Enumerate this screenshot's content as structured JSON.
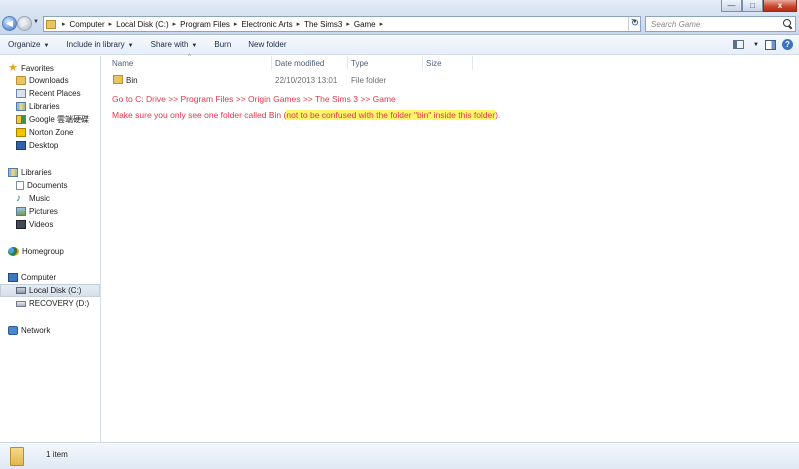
{
  "address": {
    "crumbs": [
      "Computer",
      "Local Disk (C:)",
      "Program Files",
      "Electronic Arts",
      "The Sims3",
      "Game"
    ],
    "search_placeholder": "Search Game"
  },
  "window_buttons": {
    "minimize": "—",
    "maximize": "□",
    "close": "x"
  },
  "toolbar": {
    "organize": "Organize",
    "include_in_library": "Include in library",
    "share_with": "Share with",
    "burn": "Burn",
    "new_folder": "New folder"
  },
  "navpane": {
    "favorites": {
      "header": "Favorites",
      "items": [
        "Downloads",
        "Recent Places",
        "Libraries",
        "Google 雲端硬碟",
        "Norton Zone",
        "Desktop"
      ]
    },
    "libraries": {
      "header": "Libraries",
      "items": [
        "Documents",
        "Music",
        "Pictures",
        "Videos"
      ]
    },
    "homegroup": "Homegroup",
    "computer": {
      "header": "Computer",
      "items": [
        "Local Disk (C:)",
        "RECOVERY (D:)"
      ]
    },
    "network": "Network"
  },
  "columns": {
    "name": "Name",
    "date_modified": "Date modified",
    "type": "Type",
    "size": "Size"
  },
  "files": [
    {
      "name": "Bin",
      "date_modified": "22/10/2013 13:01",
      "type": "File folder",
      "size": ""
    }
  ],
  "annotations": {
    "line1": "Go to C: Drive >> Program Files >> Origin Games >> The Sims 3 >> Game",
    "line2_prefix": "Make sure you only see one folder called Bin (",
    "line2_highlight": "not to be confused with the folder \"bin\" inside this folder",
    "line2_suffix": ").",
    "text_color": "#e0384a",
    "highlight_color": "#fdf66b"
  },
  "details": {
    "item_count": "1 item"
  }
}
